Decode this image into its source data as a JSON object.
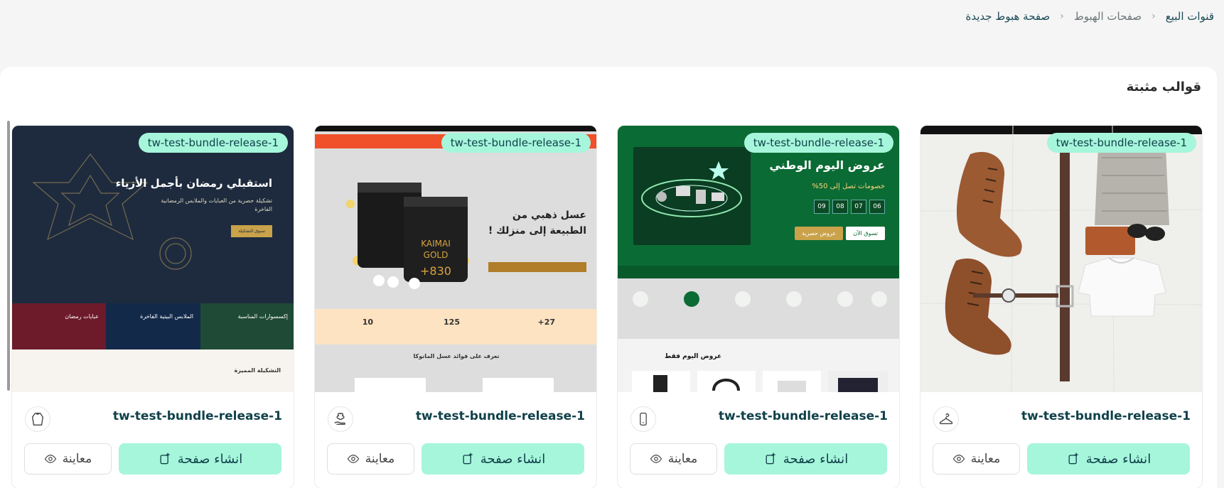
{
  "breadcrumb": {
    "root": "قنوات البيع",
    "middle": "صفحات الهبوط",
    "current": "صفحة هبوط جديدة",
    "separator": "‹"
  },
  "section": {
    "title": "قوالب مثبتة"
  },
  "templates": [
    {
      "name": "tw-test-bundle-release-1",
      "badge": "tw-test-bundle-release-1",
      "category_icon": "hanger-icon",
      "create_label": "انشاء صفحة",
      "preview_label": "معاينة"
    },
    {
      "name": "tw-test-bundle-release-1",
      "badge": "tw-test-bundle-release-1",
      "category_icon": "phone-icon",
      "create_label": "انشاء صفحة",
      "preview_label": "معاينة",
      "thumb": {
        "headline": "عروض اليوم الوطني",
        "sub": "خصومات تصل إلى 50%",
        "countdown": [
          "06",
          "07",
          "08",
          "09"
        ],
        "shop_now": "تسوق الآن",
        "exclusive": "عروض حصرية",
        "deals_title": "عروض اليوم فقط"
      }
    },
    {
      "name": "tw-test-bundle-release-1",
      "badge": "tw-test-bundle-release-1",
      "category_icon": "flower-hand-icon",
      "create_label": "انشاء صفحة",
      "preview_label": "معاينة",
      "thumb": {
        "headline1": "عسل ذهبي من",
        "headline2": "الطبيعة إلى منزلك !",
        "stat1": "27+",
        "stat2": "125",
        "stat3": "10",
        "section": "تعرف على فوائد عسل المانوكا",
        "jar_text": "KAIMAI GOLD"
      }
    },
    {
      "name": "tw-test-bundle-release-1",
      "badge": "tw-test-bundle-release-1",
      "category_icon": "abaya-icon",
      "create_label": "انشاء صفحة",
      "preview_label": "معاينة",
      "thumb": {
        "headline": "استقبلي رمضان بأجمل الأزياء",
        "sub": "تشكيلة حصرية من العبايات والملابس الرمضانية الفاخرة",
        "cta": "تسوق التشكيلة",
        "tile1": "إكسسوارات المناسبة",
        "tile2": "الملابس البيتية الفاخرة",
        "tile3": "عبايات رمضان",
        "featured": "التشكيلة المميزة"
      }
    }
  ],
  "colors": {
    "accent": "#a6f6db",
    "text_dark": "#10414a",
    "green_banner": "#0b6b34",
    "navy": "#1e2b3e"
  }
}
